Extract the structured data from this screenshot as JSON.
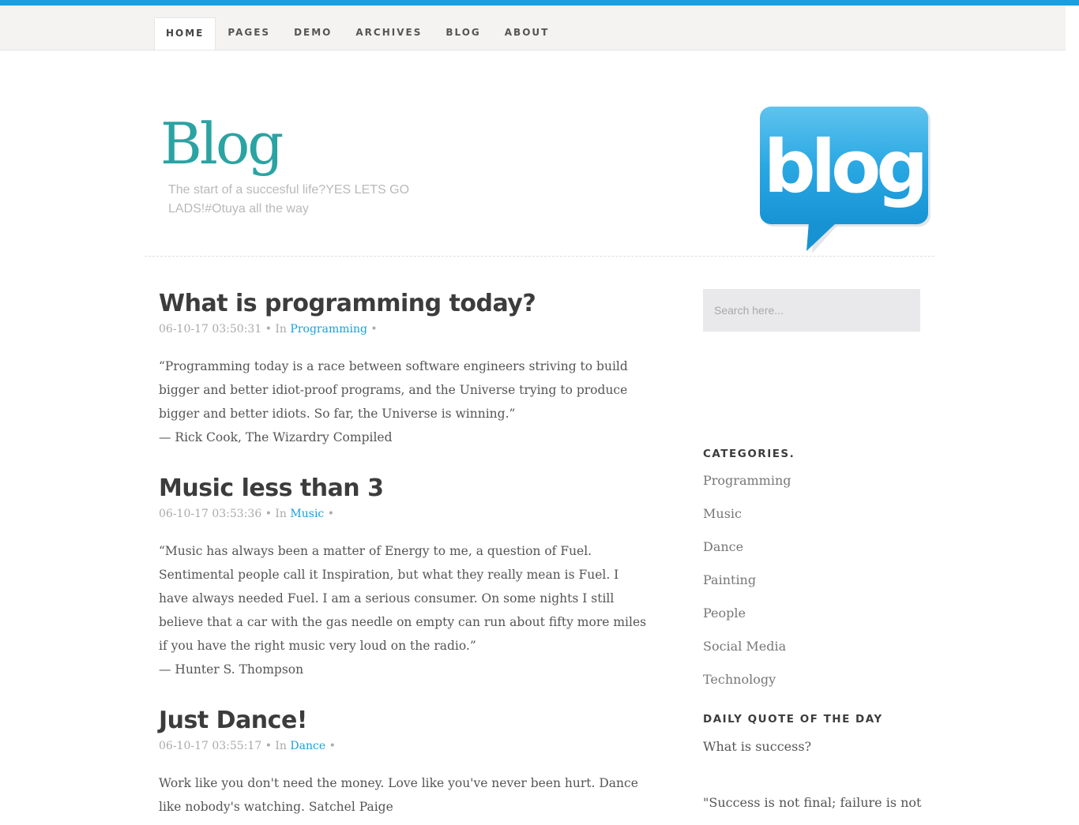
{
  "nav": {
    "items": [
      {
        "label": "HOME"
      },
      {
        "label": "PAGES"
      },
      {
        "label": "DEMO"
      },
      {
        "label": "ARCHIVES"
      },
      {
        "label": "BLOG"
      },
      {
        "label": "ABOUT"
      }
    ]
  },
  "header": {
    "title": "Blog",
    "tagline": "The start of a succesful life?YES LETS GO LADS!#Otuya all the way",
    "logo_text": "blog"
  },
  "posts": [
    {
      "title": "What is programming today?",
      "date": "06-10-17 03:50:31",
      "in_label": "In",
      "category": "Programming",
      "paragraphs": [
        "“Programming today is a race between software engineers striving to build bigger and better idiot-proof programs, and the Universe trying to produce bigger and better idiots. So far, the Universe is winning.”",
        "— Rick Cook, The Wizardry Compiled"
      ]
    },
    {
      "title": "Music less than 3",
      "date": "06-10-17 03:53:36",
      "in_label": "In",
      "category": "Music",
      "paragraphs": [
        "“Music has always been a matter of Energy to me, a question of Fuel. Sentimental people call it Inspiration, but what they really mean is Fuel. I have always needed Fuel. I am a serious consumer. On some nights I still believe that a car with the gas needle on empty can run about fifty more miles if you have the right music very loud on the radio.”",
        "— Hunter S. Thompson"
      ]
    },
    {
      "title": "Just Dance!",
      "date": "06-10-17 03:55:17",
      "in_label": "In",
      "category": "Dance",
      "paragraphs": [
        "Work like you don't need the money. Love like you've never been hurt. Dance like nobody's watching. Satchel Paige"
      ]
    }
  ],
  "sidebar": {
    "search_placeholder": "Search here...",
    "categories_title": "CATEGORIES.",
    "categories": [
      "Programming",
      "Music",
      "Dance",
      "Painting",
      "People",
      "Social Media",
      "Technology"
    ],
    "quote_title": "DAILY QUOTE OF THE DAY",
    "quote_question": "What is success?",
    "quote_text": "\"Success is not final; failure is not"
  },
  "colors": {
    "accent": "#1a9fe0",
    "title_teal": "#2aa3a3",
    "link": "#1a9fd9"
  }
}
